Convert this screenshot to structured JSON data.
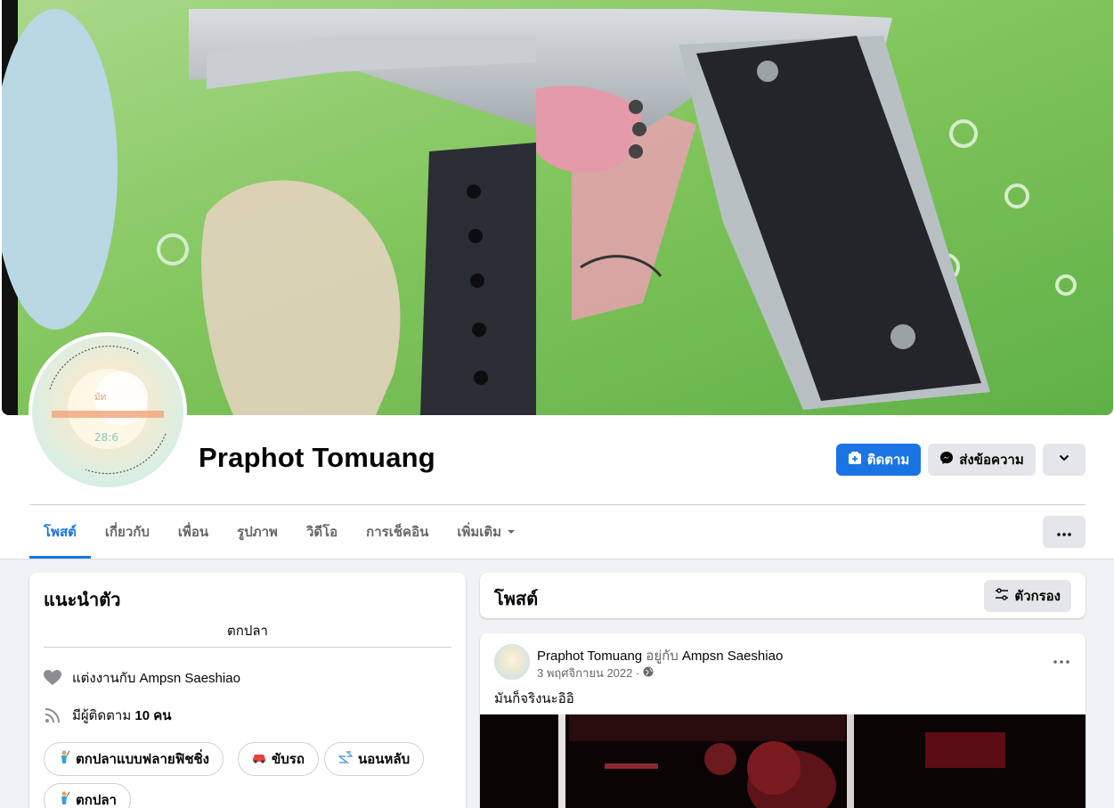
{
  "profile": {
    "name": "Praphot Tomuang"
  },
  "actions": {
    "follow_label": "ติดตาม",
    "message_label": "ส่งข้อความ"
  },
  "tabs": [
    {
      "label": "โพสต์"
    },
    {
      "label": "เกี่ยวกับ"
    },
    {
      "label": "เพื่อน"
    },
    {
      "label": "รูปภาพ"
    },
    {
      "label": "วิดีโอ"
    },
    {
      "label": "การเช็คอิน"
    },
    {
      "label": "เพิ่มเติม"
    }
  ],
  "intro": {
    "title": "แนะนำตัว",
    "bio": "ตกปลา",
    "relationship": "แต่งงานกับ Ampsn Saeshiao",
    "followers_prefix": "มีผู้ติดตาม ",
    "followers_count": "10 คน",
    "hobbies": [
      "ตกปลาแบบฟลายฟิชชิ่ง",
      "ขับรถ",
      "นอนหลับ",
      "ตกปลา"
    ]
  },
  "posts_header": {
    "title": "โพสต์",
    "filter_label": "ตัวกรอง"
  },
  "post": {
    "author": "Praphot Tomuang",
    "with_text": " อยู่กับ ",
    "tagged": "Ampsn Saeshiao",
    "date": "3 พฤศจิกายน 2022 ·",
    "text": "มันก็จริงนะอิอิ"
  },
  "colors": {
    "accent": "#1b74e4",
    "button_gray": "#e4e6eb",
    "page_bg": "#f0f2f5"
  }
}
